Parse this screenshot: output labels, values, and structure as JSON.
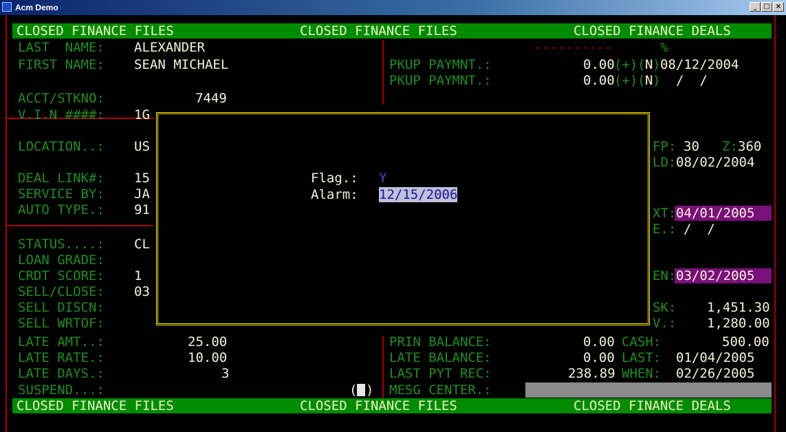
{
  "window": {
    "title": "Acm Demo",
    "min": "_",
    "max": "□",
    "close": "×"
  },
  "banners": {
    "left": "CLOSED FINANCE FILES",
    "middle": "CLOSED FINANCE FILES",
    "right": "CLOSED FINANCE DEALS"
  },
  "fields": {
    "last_name_label": "LAST  NAME:",
    "last_name": "ALEXANDER",
    "first_name_label": "FIRST NAME:",
    "first_name": "SEAN MICHAEL",
    "acct_label": "ACCT/STKNO:",
    "acct": "7449",
    "vin_label": "V.I.N ####:",
    "vin": "1G",
    "location_label": "LOCATION..:",
    "location": "US",
    "deal_link_label": "DEAL LINK#:",
    "deal_link": "15",
    "service_by_label": "SERVICE BY:",
    "service_by": "JA",
    "auto_type_label": "AUTO TYPE.:",
    "auto_type": "91",
    "status_label": "STATUS....:",
    "status": "CL",
    "loan_grade_label": "LOAN GRADE:",
    "crdt_score_label": "CRDT SCORE:",
    "crdt_score": "1",
    "sell_close_label": "SELL/CLOSE:",
    "sell_close": "03",
    "sell_discn_label": "SELL DISCN:",
    "sell_wrtof_label": "SELL WRTOF:",
    "late_amt_label": "LATE AMT..:",
    "late_amt": "25.00",
    "late_rate_label": "LATE RATE.:",
    "late_rate": "10.00",
    "late_days_label": "LATE DAYS.:",
    "late_days": "3",
    "suspend_label": "SUSPEND...:",
    "suspend_open": "(",
    "suspend_close": ")"
  },
  "right": {
    "dashes": "----------",
    "percent": "%",
    "pkup1_label": "PKUP PAYMNT.:",
    "pkup1_value": "0.00",
    "pkup1_plus": "(+)",
    "pkup1_flag_open": "(",
    "pkup1_flag": "N",
    "pkup1_flag_close": ")",
    "pkup1_date": "08/12/2004",
    "pkup2_label": "PKUP PAYMNT.:",
    "pkup2_value": "0.00",
    "pkup2_plus": "(+)",
    "pkup2_flag_open": "(",
    "pkup2_flag": "N",
    "pkup2_flag_close": ")",
    "pkup2_date": "/  /",
    "fp_label": "FP:",
    "fp_value": "30",
    "z_label": "Z:",
    "z_value": "360",
    "ld_label": "LD:",
    "ld_value": "08/02/2004",
    "xt_label": "XT:",
    "xt_value": "04/01/2005",
    "e_label": "E.:",
    "e_value": "/  /",
    "en_label": "EN:",
    "en_value": "03/02/2005",
    "sk_label": "SK:",
    "sk_value": "1,451.30",
    "v_label": "V.:",
    "v_value": "1,280.00",
    "prin_label": "PRIN BALANCE:",
    "prin_value": "0.00",
    "cash_label": "CASH:",
    "cash_value": "500.00",
    "late_bal_label": "LATE BALANCE:",
    "late_bal_value": "0.00",
    "last_label": "LAST:",
    "last_value": "01/04/2005",
    "last_pyt_label": "LAST PYT REC:",
    "last_pyt_value": "238.89",
    "when_label": "WHEN:",
    "when_value": "02/26/2005",
    "mesg_label": "MESG CENTER.:"
  },
  "modal": {
    "flag_label": "Flag.:",
    "flag_value": "Y",
    "alarm_label": "Alarm:",
    "alarm_value": "12/15/2006"
  },
  "colors": {
    "label_green": "#1f8f1f",
    "value_white": "#f4f4d8",
    "banner_green": "#008c00",
    "border_red": "#a80000",
    "modal_border": "#ffee00",
    "highlight_purple": "#7a107a"
  }
}
